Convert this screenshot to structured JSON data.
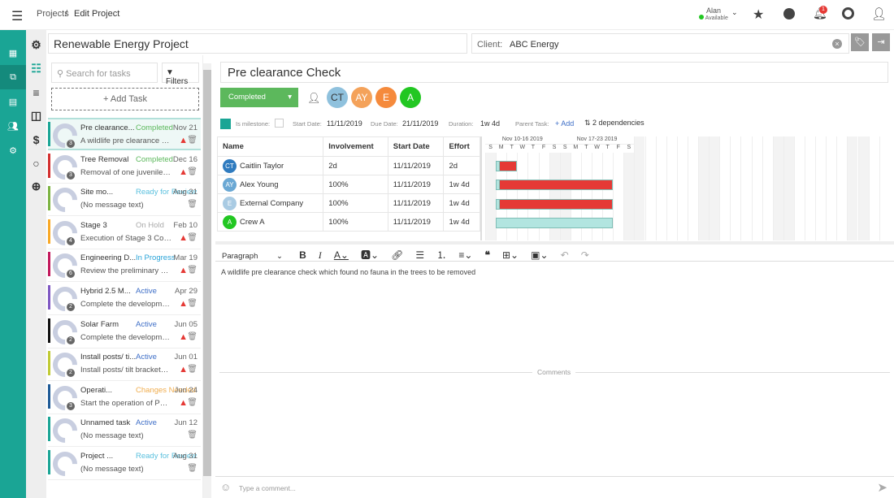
{
  "header": {
    "breadcrumb_root": "Projects",
    "breadcrumb_sep": "/",
    "breadcrumb_current": "Edit Project",
    "user_name": "Alan",
    "user_status": "Available",
    "notification_count": "1"
  },
  "project": {
    "title": "Renewable Energy Project",
    "client_label": "Client:",
    "client_value": "ABC Energy"
  },
  "tasklist": {
    "search_placeholder": "Search for tasks",
    "filters_label": "Filters",
    "add_task_label": "+ Add Task",
    "tasks": [
      {
        "name": "Pre clearance...",
        "status": "Completed",
        "status_color": "#5cb85c",
        "date": "Nov 21",
        "desc": "A wildlife pre clearance chec...",
        "bar": "#1aa595",
        "count": "3",
        "warn": true,
        "selected": true
      },
      {
        "name": "Tree Removal",
        "status": "Completed",
        "status_color": "#5cb85c",
        "date": "Dec 16",
        "desc": "Removal of one juvenile Riv...",
        "bar": "#d32f2f",
        "count": "3",
        "warn": true
      },
      {
        "name": "Site mo...",
        "status": "Ready for Review",
        "status_color": "#5bc0de",
        "date": "Aug 31",
        "desc": "(No message text)",
        "bar": "#7cb342",
        "count": "",
        "warn": false
      },
      {
        "name": "Stage 3",
        "status": "On Hold",
        "status_color": "#aaaaaa",
        "date": "Feb 10",
        "desc": "Execution of Stage 3 Conne...",
        "bar": "#f9a825",
        "count": "4",
        "warn": true
      },
      {
        "name": "Engineering D...",
        "status": "In Progress",
        "status_color": "#29a3d8",
        "date": "Mar 19",
        "desc": "Review the preliminary engin...",
        "bar": "#c2185b",
        "count": "6",
        "warn": true
      },
      {
        "name": "Hybrid 2.5 M...",
        "status": "Active",
        "status_color": "#3f6fc7",
        "date": "Apr 29",
        "desc": "Complete the development o...",
        "bar": "#7e57c2",
        "count": "2",
        "warn": true
      },
      {
        "name": "Solar Farm",
        "status": "Active",
        "status_color": "#3f6fc7",
        "date": "Jun 05",
        "desc": "Complete the development o...",
        "bar": "#111111",
        "count": "2",
        "warn": true
      },
      {
        "name": "Install posts/ ti...",
        "status": "Active",
        "status_color": "#3f6fc7",
        "date": "Jun 01",
        "desc": "Install posts/ tilt brackets acc...",
        "bar": "#c0ca33",
        "count": "2",
        "warn": true
      },
      {
        "name": "Operati...",
        "status": "Changes Needed",
        "status_color": "#f0ad4e",
        "date": "Jun 24",
        "desc": "Start the operation of Power ...",
        "bar": "#1e5a96",
        "count": "3",
        "warn": true
      },
      {
        "name": "Unnamed task",
        "status": "Active",
        "status_color": "#3f6fc7",
        "date": "Jun 12",
        "desc": "(No message text)",
        "bar": "#1aa595",
        "count": "",
        "warn": false
      },
      {
        "name": "Project ...",
        "status": "Ready for Review",
        "status_color": "#5bc0de",
        "date": "Aug 31",
        "desc": "(No message text)",
        "bar": "#1aa595",
        "count": "",
        "warn": false
      }
    ]
  },
  "task": {
    "title": "Pre clearance Check",
    "status": "Completed",
    "status_color": "#5cb85c",
    "assignees": [
      {
        "initials": "CT",
        "color": "#8fc1dd"
      },
      {
        "initials": "AY",
        "color": "#f4a25a"
      },
      {
        "initials": "E",
        "color": "#f58a3c"
      },
      {
        "initials": "A",
        "color": "#22c722"
      }
    ],
    "milestone_label": "Is milestone:",
    "start_label": "Start Date:",
    "start": "11/11/2019",
    "due_label": "Due Date:",
    "due": "21/11/2019",
    "duration_label": "Duration:",
    "duration": "1w 4d",
    "parent_label": "Parent Task:",
    "parent_add": "+ Add",
    "dependencies": "2 dependencies",
    "columns": [
      "Name",
      "Involvement",
      "Start Date",
      "Effort"
    ],
    "resources": [
      {
        "initials": "CT",
        "color": "#2f7bbf",
        "name": "Caitlin Taylor",
        "involvement": "2d",
        "start": "11/11/2019",
        "effort": "2d",
        "bar_days": 2,
        "bar_color": "#e53935"
      },
      {
        "initials": "AY",
        "color": "#6aa8d4",
        "name": "Alex Young",
        "involvement": "100%",
        "start": "11/11/2019",
        "effort": "1w 4d",
        "bar_days": 11,
        "bar_color": "#e53935"
      },
      {
        "initials": "E",
        "color": "#a9cbe3",
        "name": "External Company",
        "involvement": "100%",
        "start": "11/11/2019",
        "effort": "1w 4d",
        "bar_days": 11,
        "bar_color": "#e53935"
      },
      {
        "initials": "A",
        "color": "#22c722",
        "name": "Crew A",
        "involvement": "100%",
        "start": "11/11/2019",
        "effort": "1w 4d",
        "bar_days": 11,
        "bar_color": "#b2e5e0"
      }
    ],
    "weeks": [
      "Nov 10-16 2019",
      "Nov 17-23 2019"
    ],
    "days": [
      "S",
      "M",
      "T",
      "W",
      "T",
      "F",
      "S",
      "S",
      "M",
      "T",
      "W",
      "T",
      "F",
      "S"
    ],
    "editor": {
      "paragraph": "Paragraph",
      "content": "A wildlife pre clearance check which found no fauna in the trees to be removed"
    },
    "comments_label": "Comments",
    "comment_placeholder": "Type a comment..."
  }
}
